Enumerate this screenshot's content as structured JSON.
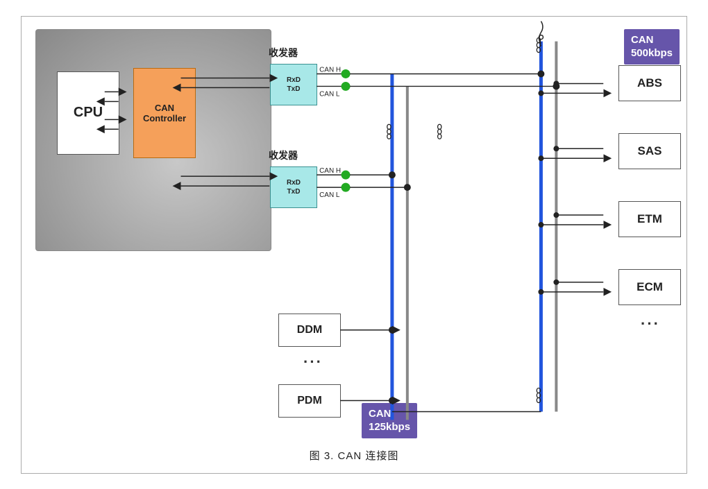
{
  "diagram": {
    "outer_caption": "图 3.    CAN 连接图",
    "ecu": {
      "cpu_label": "CPU",
      "can_controller_label": "CAN\nController"
    },
    "transceivers": [
      {
        "label": "收发器",
        "rx_label": "RxD",
        "tx_label": "TxD",
        "canh": "CAN H",
        "canl": "CAN L"
      },
      {
        "label": "收发器",
        "rx_label": "RxD",
        "tx_label": "TxD",
        "canh": "CAN H",
        "canl": "CAN L"
      }
    ],
    "can_badges": [
      {
        "text": "CAN\n500kbps",
        "position": "top-right"
      },
      {
        "text": "CAN\n125kbps",
        "position": "bottom-mid"
      }
    ],
    "right_devices": [
      "ABS",
      "SAS",
      "ETM",
      "ECM"
    ],
    "bottom_devices": [
      "DDM",
      "PDM"
    ],
    "dots": "···"
  }
}
